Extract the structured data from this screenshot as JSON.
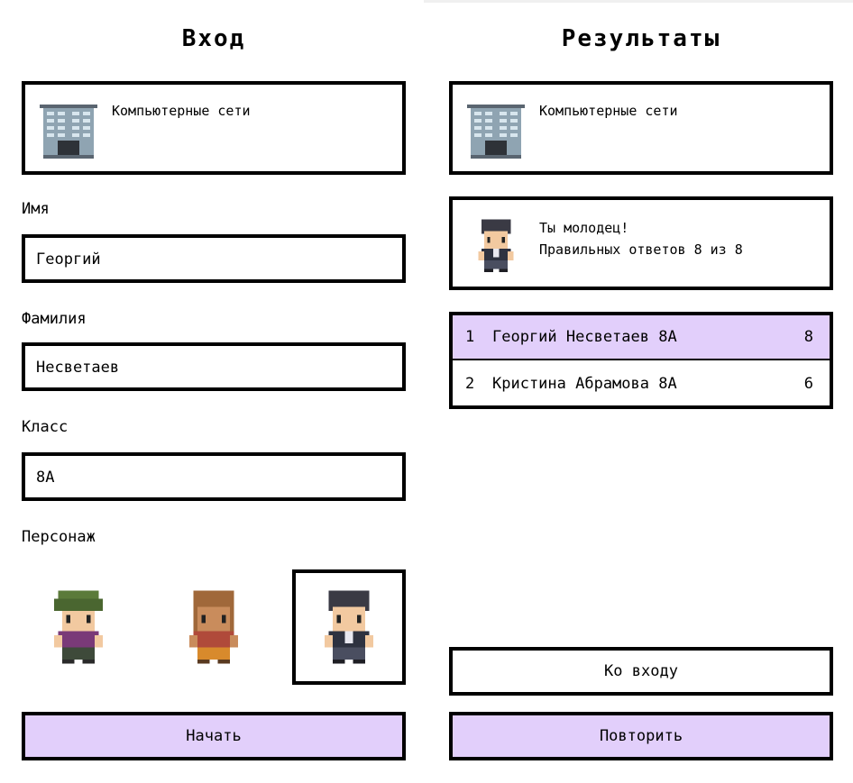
{
  "login": {
    "title": "Вход",
    "course": "Компьютерные сети",
    "name_label": "Имя",
    "name_value": "Георгий",
    "surname_label": "Фамилия",
    "surname_value": "Несветаев",
    "class_label": "Класс",
    "class_value": "8А",
    "character_label": "Персонаж",
    "characters": [
      "green-hair-character",
      "brown-hair-character",
      "dark-hair-suit-character"
    ],
    "selected_character": 3,
    "start_button": "Начать"
  },
  "results": {
    "title": "Результаты",
    "course": "Компьютерные сети",
    "message_line1": "Ты молодец!",
    "message_line2": "Правильных ответов 8 из 8",
    "leaderboard": [
      {
        "rank": "1",
        "name": "Георгий Несветаев 8А",
        "score": "8"
      },
      {
        "rank": "2",
        "name": "Кристина Абрамова 8А",
        "score": "6"
      }
    ],
    "back_button": "Ко входу",
    "repeat_button": "Повторить"
  },
  "colors": {
    "accent": "#e2cffb",
    "border": "#000000"
  }
}
